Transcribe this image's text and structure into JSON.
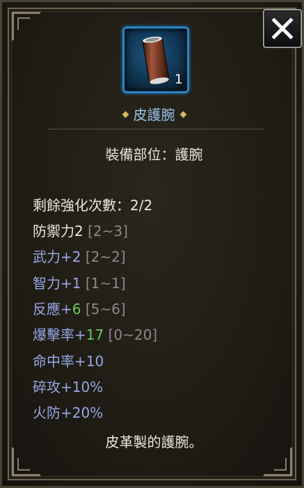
{
  "item": {
    "name": "皮護腕",
    "quantity": "1",
    "slot_text": "裝備部位：護腕",
    "description": "皮革製的護腕。"
  },
  "stats": {
    "enhance": "剩餘強化次數：2/2",
    "defense": {
      "label": "防禦力2",
      "range": "[2~3]"
    },
    "str": {
      "label": "武力+2",
      "range": "[2~2]"
    },
    "int": {
      "label": "智力+1",
      "range": "[1~1]"
    },
    "react": {
      "label": "反應+",
      "bonus": "6",
      "range": "[5~6]"
    },
    "crit": {
      "label": "爆擊率+",
      "bonus": "17",
      "range": "[0~20]"
    },
    "hit": {
      "label": "命中率+10"
    },
    "break": {
      "label": "碎攻+10%"
    },
    "fire": {
      "label": "火防+20%"
    }
  },
  "colors": {
    "name": "#9cc3ec",
    "stat_blue": "#98a7e6",
    "bonus_green": "#6ac95a",
    "range_gray": "#8a8a8a"
  },
  "icons": {
    "close": "close-x-icon",
    "item": "leather-bracer-icon"
  }
}
